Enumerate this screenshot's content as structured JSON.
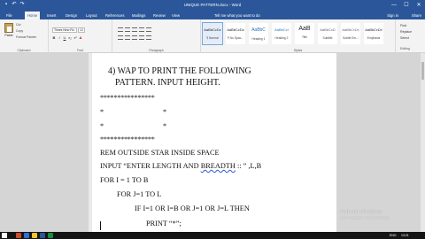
{
  "window": {
    "title": "UNIQUE PATTERN.docx - Word",
    "controls": [
      "—",
      "☐",
      "✕"
    ]
  },
  "ribbon_tabs": {
    "file": "File",
    "home": "Home",
    "insert": "Insert",
    "design": "Design",
    "layout": "Layout",
    "references": "References",
    "mailings": "Mailings",
    "review": "Review",
    "view": "View",
    "tell_me": "Tell me what you want to do",
    "sign_in": "Sign in",
    "share": "Share"
  },
  "clipboard": {
    "paste": "Paste",
    "cut": "Cut",
    "copy": "Copy",
    "format_painter": "Format Painter",
    "label": "Clipboard"
  },
  "font": {
    "name": "Times New Ro",
    "size": "12",
    "label": "Font",
    "buttons": [
      "B",
      "I",
      "U",
      "x₂",
      "x²",
      "A"
    ]
  },
  "paragraph": {
    "label": "Paragraph"
  },
  "styles": {
    "label": "Styles",
    "items": [
      {
        "sample": "AaBbCcDc",
        "name": "¶ Normal"
      },
      {
        "sample": "AaBbCcDc",
        "name": "¶ No Spac..."
      },
      {
        "sample": "AaBbC",
        "name": "Heading 1"
      },
      {
        "sample": "AaBbCcI",
        "name": "Heading 2"
      },
      {
        "sample": "AaB",
        "name": "Title"
      },
      {
        "sample": "AaBbCcD",
        "name": "Subtitle"
      },
      {
        "sample": "AaBbCcDc",
        "name": "Subtle Em..."
      },
      {
        "sample": "AaBbCcDc",
        "name": "Emphasis"
      }
    ]
  },
  "editing": {
    "find": "Find",
    "replace": "Replace",
    "select": "Select",
    "label": "Editing"
  },
  "document": {
    "heading_line1": "4)      WAP TO PRINT THE FOLLOWING",
    "heading_line2": "PATTERN. INPUT HEIGHT.",
    "stars_full": "****************",
    "star_row_left": "*",
    "star_row_right": "*",
    "line_rem": "REM OUTSIDE STAR INSIDE SPACE",
    "line_input_a": "INPUT “ENTER LENGTH AND ",
    "line_input_b": "BREADTH",
    "line_input_c": " :: ” ,L,B",
    "line_for_i": "FOR I = 1  TO B",
    "line_for_j": "FOR J=1  TO L",
    "line_if": "IF I=1 OR I=B OR J=1 OR J=L THEN",
    "line_print": "PRINT “*”;"
  },
  "watermark": {
    "line1": "Activate Windows",
    "line2": "Go to Settings to activate Windows."
  },
  "taskbar": {
    "language": "ENG",
    "time": "13:21",
    "icon_colors": [
      "#d14b2c",
      "#2f6fcf",
      "#f2c12e",
      "#2b579a",
      "#1e8a3c"
    ]
  }
}
